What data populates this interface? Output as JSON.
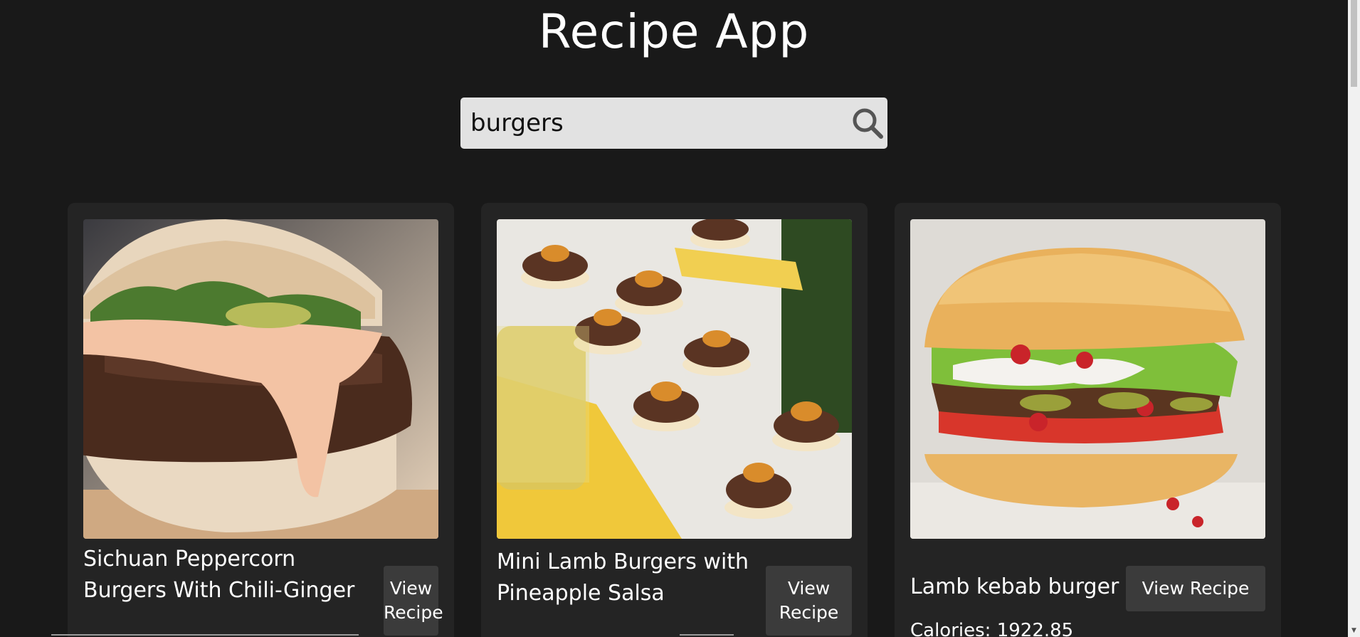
{
  "header": {
    "title": "Recipe App"
  },
  "search": {
    "value": "burgers",
    "icon": "search-icon"
  },
  "recipes": [
    {
      "title_lines": [
        "Sichuan Peppercorn",
        "Burgers With Chili-Ginger"
      ],
      "button_lines": [
        "View",
        "Recipe"
      ]
    },
    {
      "title_lines": [
        "Mini Lamb Burgers with",
        "Pineapple Salsa"
      ],
      "button_lines": [
        "View",
        "Recipe"
      ]
    },
    {
      "title_lines": [
        "Lamb kebab burger"
      ],
      "button_label": "View Recipe",
      "calories_label": "Calories: 1922.85"
    }
  ],
  "colors": {
    "background": "#191919",
    "card": "#242424",
    "button": "#3b3b3b",
    "search_bg": "#e2e2e2"
  }
}
